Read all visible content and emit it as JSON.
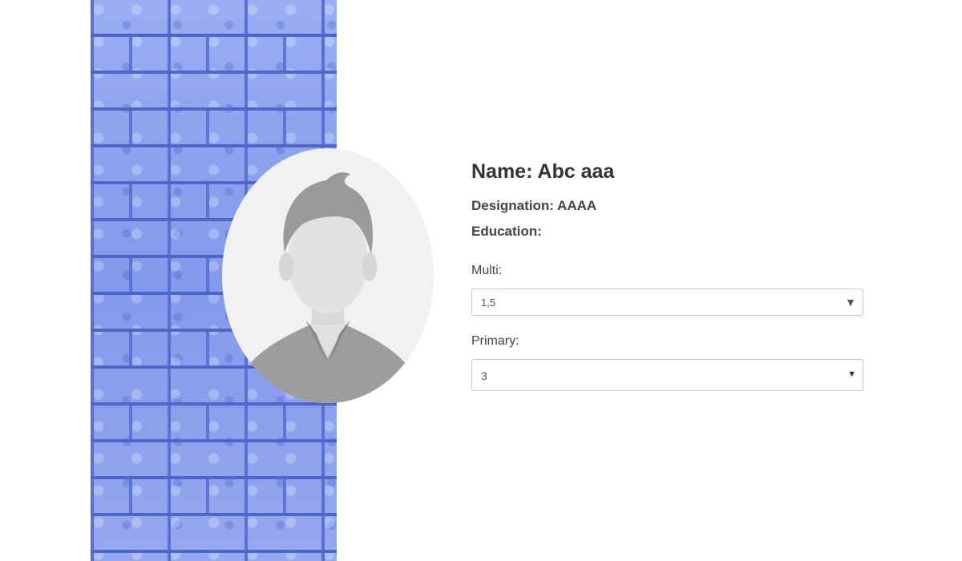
{
  "profile": {
    "name": "Name: Abc aaa",
    "designation": "Designation: AAAA",
    "education": "Education:"
  },
  "form": {
    "multi": {
      "label": "Multi:",
      "value": "1,5"
    },
    "primary": {
      "label": "Primary:",
      "value": "3"
    }
  },
  "icons": {
    "multi_arrow": "▼",
    "primary_arrow": "▼"
  },
  "colors": {
    "brick": "#8ea3ee",
    "avatar_bg": "#f1f1f1"
  }
}
